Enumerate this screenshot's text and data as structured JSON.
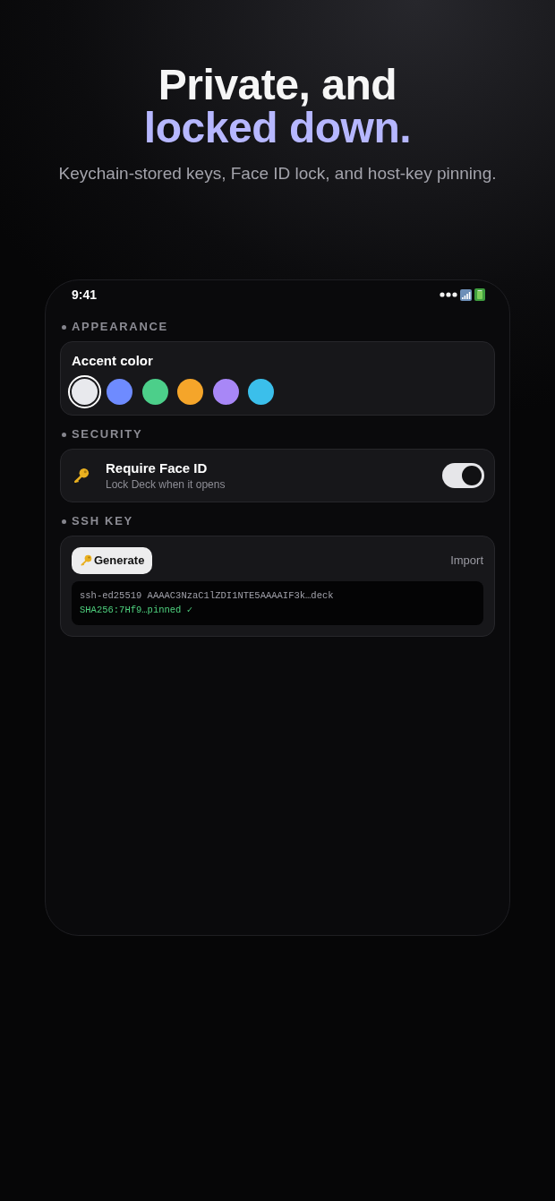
{
  "hero": {
    "headline": [
      {
        "kind": "plain",
        "text": "Private, and"
      },
      {
        "kind": "accent",
        "text": "locked down."
      }
    ],
    "subtitle": "Keychain-stored keys, Face ID lock, and host-key pinning."
  },
  "phone": {
    "status_bar": {
      "time": "9:41"
    },
    "sections": [
      {
        "kind": "swatches",
        "label": "APPEARANCE",
        "title": "Accent color",
        "swatches": [
          {
            "color": "#e8e9ed",
            "selected": true
          },
          {
            "color": "#6e8bff",
            "selected": false
          },
          {
            "color": "#4ccf8a",
            "selected": false
          },
          {
            "color": "#f5a52a",
            "selected": false
          },
          {
            "color": "#a887f7",
            "selected": false
          },
          {
            "color": "#3bbfeb",
            "selected": false
          }
        ]
      },
      {
        "kind": "toggle",
        "label": "SECURITY",
        "title": "Require Face ID",
        "subtitle": "Lock Deck when it opens",
        "on": true
      },
      {
        "kind": "ssh",
        "label": "SSH KEY",
        "primary_button": "Generate",
        "secondary_button": "Import",
        "key_lines": [
          {
            "kind": "key",
            "text": "ssh-ed25519 AAAAC3NzaC1lZDI1NTE5AAAAIF3k…deck"
          },
          {
            "kind": "fingerprint",
            "text": "SHA256:7Hf9…pinned ✓"
          }
        ]
      }
    ]
  }
}
